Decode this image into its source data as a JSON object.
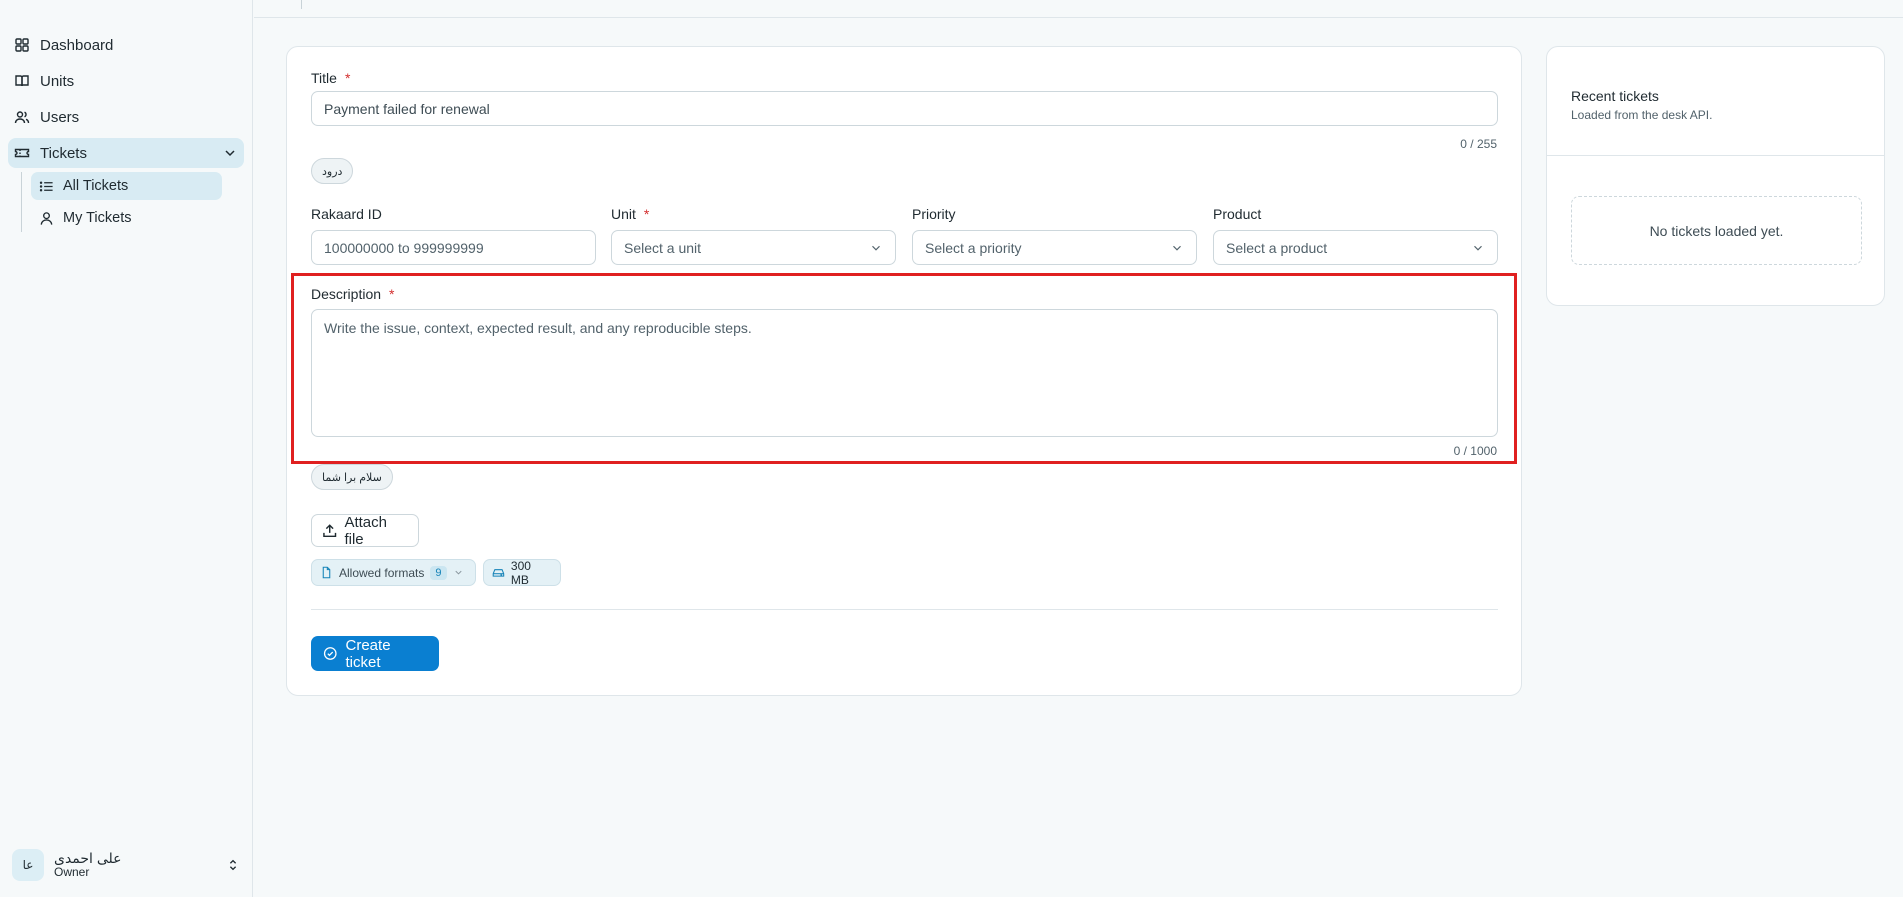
{
  "sidebar": {
    "items": [
      {
        "label": "Dashboard",
        "icon": "dashboard-icon"
      },
      {
        "label": "Units",
        "icon": "book-icon"
      },
      {
        "label": "Users",
        "icon": "users-icon"
      },
      {
        "label": "Tickets",
        "icon": "ticket-icon"
      }
    ],
    "sub_items": [
      {
        "label": "All Tickets",
        "icon": "list-icon"
      },
      {
        "label": "My Tickets",
        "icon": "user-icon"
      }
    ],
    "user": {
      "initials": "عا",
      "name": "علی احمدی",
      "role": "Owner"
    }
  },
  "form": {
    "title_label": "Title",
    "title_value": "Payment failed for renewal",
    "title_counter": "0 / 255",
    "title_pill": "درود",
    "rakaard_label": "Rakaard ID",
    "rakaard_placeholder": "100000000 to 999999999",
    "unit_label": "Unit",
    "unit_placeholder": "Select a unit",
    "priority_label": "Priority",
    "priority_placeholder": "Select a priority",
    "product_label": "Product",
    "product_placeholder": "Select a product",
    "description_label": "Description",
    "description_placeholder": "Write the issue, context, expected result, and any reproducible steps.",
    "description_counter": "0 / 1000",
    "description_pill": "سلام برا شما",
    "attach_label": "Attach file",
    "formats_label": "Allowed formats",
    "formats_count": "9",
    "size_label": "300 MB",
    "submit_label": "Create ticket",
    "required_mark": "*"
  },
  "recent": {
    "title": "Recent tickets",
    "subtitle": "Loaded from the desk API.",
    "empty": "No tickets loaded yet."
  },
  "colors": {
    "accent": "#0a7fd1",
    "active_nav": "#d8ebf3",
    "required": "#d32f2f",
    "highlight": "#e02020"
  }
}
